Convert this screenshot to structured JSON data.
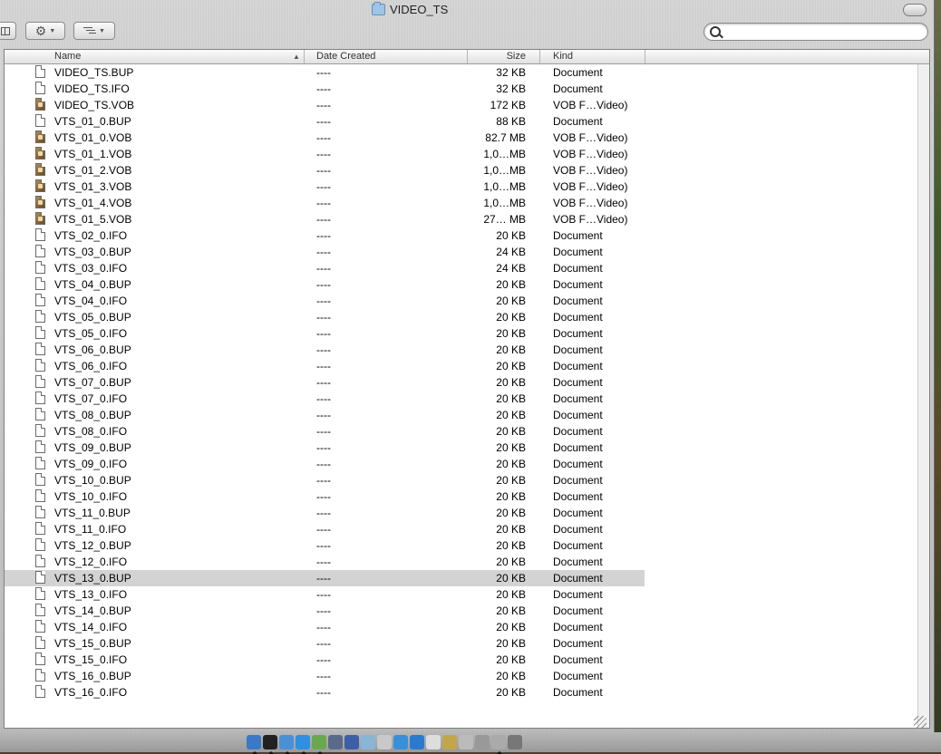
{
  "window": {
    "title": "VIDEO_TS"
  },
  "toolbar": {
    "search_placeholder": "",
    "search_value": ""
  },
  "columns": {
    "name": "Name",
    "date": "Date Created",
    "size": "Size",
    "kind": "Kind"
  },
  "files": [
    {
      "name": "VIDEO_TS.BUP",
      "date": "----",
      "size": "32 KB",
      "kind": "Document",
      "icon": "document-icon"
    },
    {
      "name": "VIDEO_TS.IFO",
      "date": "----",
      "size": "32 KB",
      "kind": "Document",
      "icon": "document-icon"
    },
    {
      "name": "VIDEO_TS.VOB",
      "date": "----",
      "size": "172 KB",
      "kind": "VOB F…Video)",
      "icon": "vob-file-icon"
    },
    {
      "name": "VTS_01_0.BUP",
      "date": "----",
      "size": "88 KB",
      "kind": "Document",
      "icon": "document-icon"
    },
    {
      "name": "VTS_01_0.VOB",
      "date": "----",
      "size": "82.7 MB",
      "kind": "VOB F…Video)",
      "icon": "vob-file-icon"
    },
    {
      "name": "VTS_01_1.VOB",
      "date": "----",
      "size": "1,0…MB",
      "kind": "VOB F…Video)",
      "icon": "vob-file-icon"
    },
    {
      "name": "VTS_01_2.VOB",
      "date": "----",
      "size": "1,0…MB",
      "kind": "VOB F…Video)",
      "icon": "vob-file-icon"
    },
    {
      "name": "VTS_01_3.VOB",
      "date": "----",
      "size": "1,0…MB",
      "kind": "VOB F…Video)",
      "icon": "vob-file-icon"
    },
    {
      "name": "VTS_01_4.VOB",
      "date": "----",
      "size": "1,0…MB",
      "kind": "VOB F…Video)",
      "icon": "vob-file-icon"
    },
    {
      "name": "VTS_01_5.VOB",
      "date": "----",
      "size": "27… MB",
      "kind": "VOB F…Video)",
      "icon": "vob-file-icon"
    },
    {
      "name": "VTS_02_0.IFO",
      "date": "----",
      "size": "20 KB",
      "kind": "Document",
      "icon": "document-icon"
    },
    {
      "name": "VTS_03_0.BUP",
      "date": "----",
      "size": "24 KB",
      "kind": "Document",
      "icon": "document-icon"
    },
    {
      "name": "VTS_03_0.IFO",
      "date": "----",
      "size": "24 KB",
      "kind": "Document",
      "icon": "document-icon"
    },
    {
      "name": "VTS_04_0.BUP",
      "date": "----",
      "size": "20 KB",
      "kind": "Document",
      "icon": "document-icon"
    },
    {
      "name": "VTS_04_0.IFO",
      "date": "----",
      "size": "20 KB",
      "kind": "Document",
      "icon": "document-icon"
    },
    {
      "name": "VTS_05_0.BUP",
      "date": "----",
      "size": "20 KB",
      "kind": "Document",
      "icon": "document-icon"
    },
    {
      "name": "VTS_05_0.IFO",
      "date": "----",
      "size": "20 KB",
      "kind": "Document",
      "icon": "document-icon"
    },
    {
      "name": "VTS_06_0.BUP",
      "date": "----",
      "size": "20 KB",
      "kind": "Document",
      "icon": "document-icon"
    },
    {
      "name": "VTS_06_0.IFO",
      "date": "----",
      "size": "20 KB",
      "kind": "Document",
      "icon": "document-icon"
    },
    {
      "name": "VTS_07_0.BUP",
      "date": "----",
      "size": "20 KB",
      "kind": "Document",
      "icon": "document-icon"
    },
    {
      "name": "VTS_07_0.IFO",
      "date": "----",
      "size": "20 KB",
      "kind": "Document",
      "icon": "document-icon"
    },
    {
      "name": "VTS_08_0.BUP",
      "date": "----",
      "size": "20 KB",
      "kind": "Document",
      "icon": "document-icon"
    },
    {
      "name": "VTS_08_0.IFO",
      "date": "----",
      "size": "20 KB",
      "kind": "Document",
      "icon": "document-icon"
    },
    {
      "name": "VTS_09_0.BUP",
      "date": "----",
      "size": "20 KB",
      "kind": "Document",
      "icon": "document-icon"
    },
    {
      "name": "VTS_09_0.IFO",
      "date": "----",
      "size": "20 KB",
      "kind": "Document",
      "icon": "document-icon"
    },
    {
      "name": "VTS_10_0.BUP",
      "date": "----",
      "size": "20 KB",
      "kind": "Document",
      "icon": "document-icon"
    },
    {
      "name": "VTS_10_0.IFO",
      "date": "----",
      "size": "20 KB",
      "kind": "Document",
      "icon": "document-icon"
    },
    {
      "name": "VTS_11_0.BUP",
      "date": "----",
      "size": "20 KB",
      "kind": "Document",
      "icon": "document-icon"
    },
    {
      "name": "VTS_11_0.IFO",
      "date": "----",
      "size": "20 KB",
      "kind": "Document",
      "icon": "document-icon"
    },
    {
      "name": "VTS_12_0.BUP",
      "date": "----",
      "size": "20 KB",
      "kind": "Document",
      "icon": "document-icon"
    },
    {
      "name": "VTS_12_0.IFO",
      "date": "----",
      "size": "20 KB",
      "kind": "Document",
      "icon": "document-icon"
    },
    {
      "name": "VTS_13_0.BUP",
      "date": "----",
      "size": "20 KB",
      "kind": "Document",
      "icon": "document-icon",
      "selected": true
    },
    {
      "name": "VTS_13_0.IFO",
      "date": "----",
      "size": "20 KB",
      "kind": "Document",
      "icon": "document-icon"
    },
    {
      "name": "VTS_14_0.BUP",
      "date": "----",
      "size": "20 KB",
      "kind": "Document",
      "icon": "document-icon"
    },
    {
      "name": "VTS_14_0.IFO",
      "date": "----",
      "size": "20 KB",
      "kind": "Document",
      "icon": "document-icon"
    },
    {
      "name": "VTS_15_0.BUP",
      "date": "----",
      "size": "20 KB",
      "kind": "Document",
      "icon": "document-icon"
    },
    {
      "name": "VTS_15_0.IFO",
      "date": "----",
      "size": "20 KB",
      "kind": "Document",
      "icon": "document-icon"
    },
    {
      "name": "VTS_16_0.BUP",
      "date": "----",
      "size": "20 KB",
      "kind": "Document",
      "icon": "document-icon"
    },
    {
      "name": "VTS_16_0.IFO",
      "date": "----",
      "size": "20 KB",
      "kind": "Document",
      "icon": "document-icon"
    }
  ],
  "dock": {
    "items": [
      {
        "icon": "finder-icon",
        "color": "#3a78c8",
        "running": true
      },
      {
        "icon": "dashboard-icon",
        "color": "#222222",
        "running": true
      },
      {
        "icon": "mail-icon",
        "color": "#4a90d9",
        "running": true
      },
      {
        "icon": "ichat-icon",
        "color": "#2f8fe0",
        "running": true
      },
      {
        "icon": "itunes-icon",
        "color": "#6aa84f",
        "running": true
      },
      {
        "icon": "iphoto-icon",
        "color": "#5a6a8a",
        "running": false
      },
      {
        "icon": "imovie-icon",
        "color": "#3d5fa8",
        "running": false
      },
      {
        "icon": "preview-icon",
        "color": "#8ab6d6",
        "running": false
      },
      {
        "icon": "dvd-icon",
        "color": "#c9c9c9",
        "running": false
      },
      {
        "icon": "quicktime-icon",
        "color": "#3a8fd9",
        "running": false
      },
      {
        "icon": "safari-icon",
        "color": "#2a7ad0",
        "running": false
      },
      {
        "icon": "pages-icon",
        "color": "#dddddd",
        "running": false
      },
      {
        "icon": "grapher-icon",
        "color": "#c2a64a",
        "running": false
      },
      {
        "icon": "app-icon",
        "color": "#bbbbbb",
        "running": false
      },
      {
        "icon": "utility-icon",
        "color": "#999999",
        "running": false
      },
      {
        "icon": "system-icon",
        "color": "#aaaaaa",
        "running": true
      },
      {
        "icon": "trash-icon",
        "color": "#777777",
        "running": false
      }
    ]
  }
}
